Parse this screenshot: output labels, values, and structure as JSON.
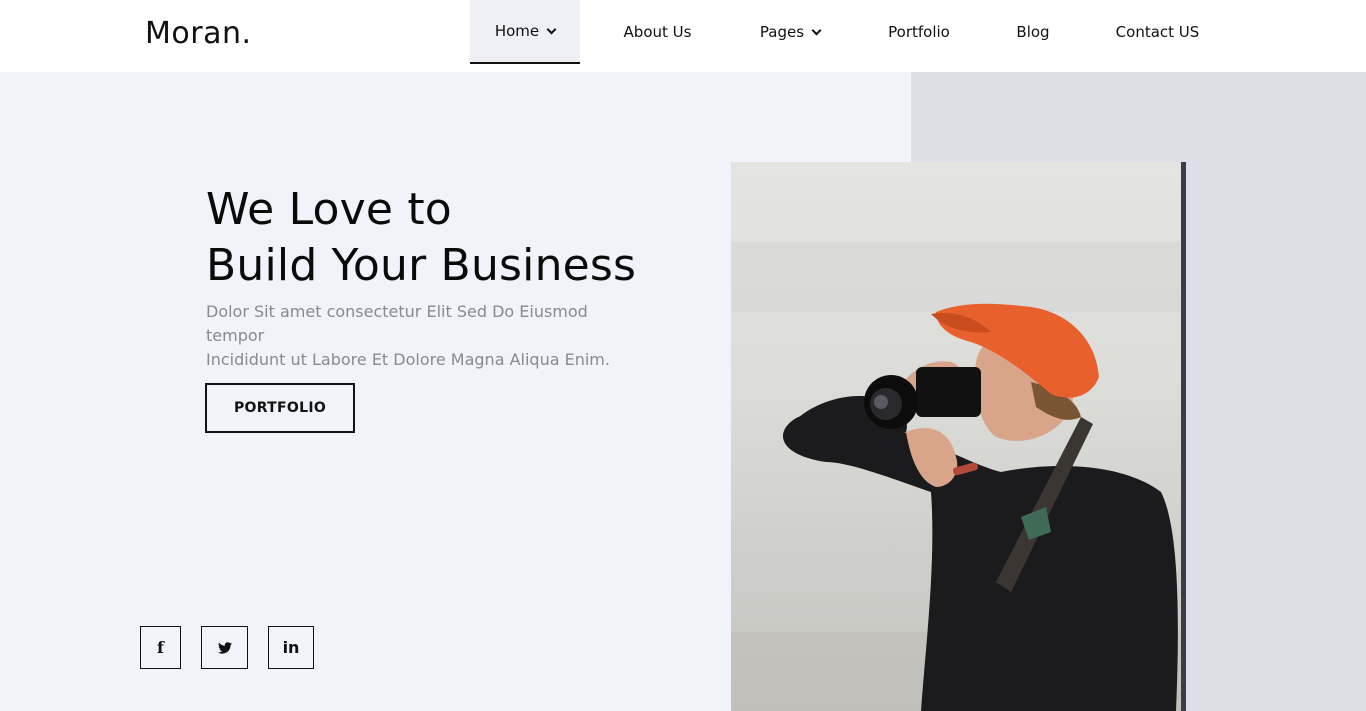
{
  "header": {
    "logo": "Moran.",
    "nav": [
      {
        "label": "Home",
        "has_dropdown": true,
        "active": true
      },
      {
        "label": "About Us",
        "has_dropdown": false
      },
      {
        "label": "Pages",
        "has_dropdown": true
      },
      {
        "label": "Portfolio",
        "has_dropdown": false
      },
      {
        "label": "Blog",
        "has_dropdown": false
      },
      {
        "label": "Contact US",
        "has_dropdown": false
      }
    ]
  },
  "hero": {
    "headline_line1": "We Love to",
    "headline_line2": "Build Your Business",
    "subtext_line1": "Dolor Sit amet consectetur Elit Sed Do Eiusmod tempor",
    "subtext_line2": "Incididunt ut Labore Et Dolore Magna Aliqua Enim.",
    "button_label": "PORTFOLIO"
  },
  "social": [
    {
      "icon": "facebook-icon",
      "glyph": "f"
    },
    {
      "icon": "twitter-icon",
      "glyph": "🐦"
    },
    {
      "icon": "linkedin-icon",
      "glyph": "in"
    }
  ],
  "colors": {
    "hero_bg": "#f0f3fa",
    "hero_right_bg": "#dddfe7",
    "text_primary": "#0a0a0a",
    "text_muted": "#8a8a8a",
    "active_nav_bg": "#eef0f6",
    "cap_orange": "#e8612c"
  }
}
